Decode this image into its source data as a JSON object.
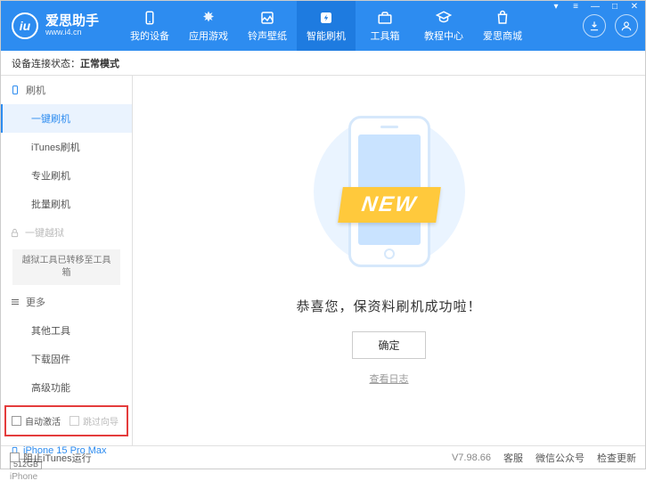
{
  "header": {
    "logo_title": "爱思助手",
    "logo_sub": "www.i4.cn",
    "nav": [
      {
        "label": "我的设备"
      },
      {
        "label": "应用游戏"
      },
      {
        "label": "铃声壁纸"
      },
      {
        "label": "智能刷机"
      },
      {
        "label": "工具箱"
      },
      {
        "label": "教程中心"
      },
      {
        "label": "爱思商城"
      }
    ]
  },
  "status": {
    "prefix": "设备连接状态：",
    "value": "正常模式"
  },
  "sidebar": {
    "group1": {
      "title": "刷机",
      "items": [
        "一键刷机",
        "iTunes刷机",
        "专业刷机",
        "批量刷机"
      ]
    },
    "group2": {
      "title": "一键越狱",
      "note": "越狱工具已转移至工具箱"
    },
    "group3": {
      "title": "更多",
      "items": [
        "其他工具",
        "下载固件",
        "高级功能"
      ]
    },
    "checks": {
      "auto_activate": "自动激活",
      "skip_guide": "跳过向导"
    },
    "device": {
      "name": "iPhone 15 Pro Max",
      "storage": "512GB",
      "type": "iPhone"
    }
  },
  "main": {
    "ribbon": "NEW",
    "success_text": "恭喜您，保资料刷机成功啦！",
    "ok_button": "确定",
    "log_link": "查看日志"
  },
  "footer": {
    "block_itunes": "阻止iTunes运行",
    "version": "V7.98.66",
    "items": [
      "客服",
      "微信公众号",
      "检查更新"
    ]
  }
}
